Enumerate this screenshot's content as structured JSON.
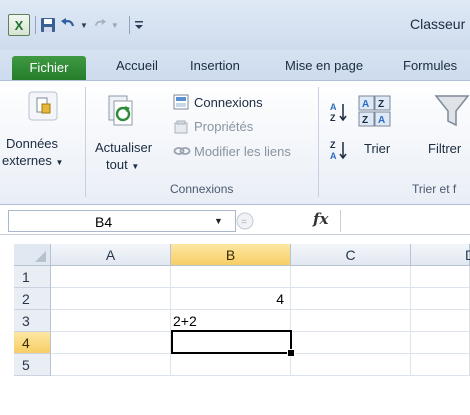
{
  "window": {
    "title": "Classeur"
  },
  "quick_access": {
    "save_icon": "save-icon",
    "undo_icon": "undo-icon",
    "redo_icon": "redo-icon",
    "customize_icon": "customize-icon"
  },
  "tabs": [
    {
      "label": "Fichier",
      "active": false,
      "file": true
    },
    {
      "label": "Accueil"
    },
    {
      "label": "Insertion"
    },
    {
      "label": "Mise en page"
    },
    {
      "label": "Formules"
    }
  ],
  "ribbon": {
    "donnees_externes": {
      "line1": "Données",
      "line2": "externes"
    },
    "actualiser": {
      "line1": "Actualiser",
      "line2": "tout"
    },
    "connexions": "Connexions",
    "proprietes": "Propriétés",
    "modifier_liens": "Modifier les liens",
    "group_connexions": "Connexions",
    "trier": "Trier",
    "filtrer": "Filtrer",
    "group_trier": "Trier et f",
    "sort_az_label": "A Z",
    "sort_za_label": "Z A"
  },
  "formula_bar": {
    "name_box": "B4",
    "fx": "fx",
    "value": ""
  },
  "grid": {
    "columns": [
      "A",
      "B",
      "C",
      "D"
    ],
    "rows": [
      "1",
      "2",
      "3",
      "4",
      "5"
    ],
    "selected_col": "B",
    "selected_row": "4",
    "cells": {
      "B2": "4",
      "B3": "2+2"
    }
  },
  "colors": {
    "file_tab": "#2d8531",
    "selection_header": "#f7ce65",
    "accent": "#cfdcee"
  }
}
